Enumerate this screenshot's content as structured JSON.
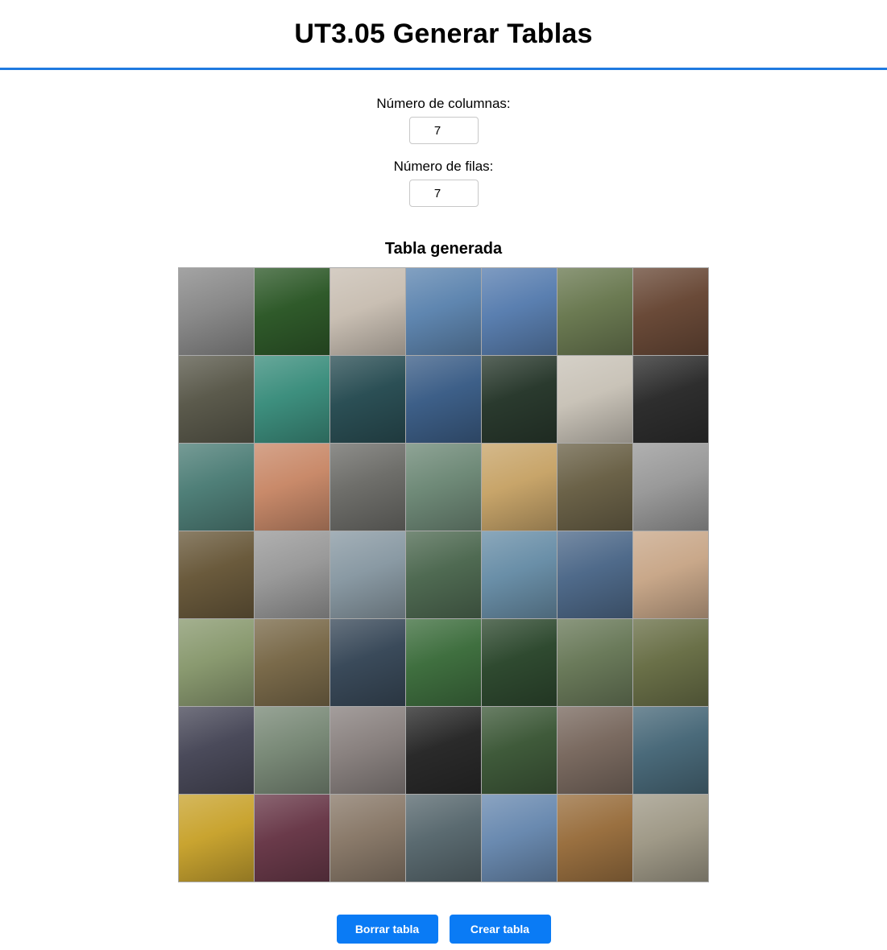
{
  "header": {
    "title": "UT3.05 Generar Tablas"
  },
  "form": {
    "columns_label": "Número de columnas:",
    "columns_value": "7",
    "rows_label": "Número de filas:",
    "rows_value": "7"
  },
  "table": {
    "title": "Tabla generada",
    "tiles": [
      [
        "#8a8a8a",
        "#2f5a2a",
        "#c9bfb3",
        "#5f86b0",
        "#5a7fb0",
        "#6b7a52",
        "#6a4a38"
      ],
      [
        "#5b5a4c",
        "#3d8f7e",
        "#2b4f55",
        "#3d5f88",
        "#2a3a2e",
        "#c9c3b8",
        "#2e2e2e"
      ],
      [
        "#4f7f78",
        "#c98a6a",
        "#6e6e6a",
        "#6f8a78",
        "#c8a56a",
        "#6b6248",
        "#9a9a9a"
      ],
      [
        "#6a5a3c",
        "#9a9a9a",
        "#8a9aa4",
        "#4f6a52",
        "#6a8fa8",
        "#4f6a8a",
        "#c9a88a"
      ],
      [
        "#8a9a70",
        "#7a6a4a",
        "#3a4a5a",
        "#3f6f3f",
        "#2f4a30",
        "#6a7a5a",
        "#6a7048"
      ],
      [
        "#4a4a5a",
        "#7a8a78",
        "#8a8280",
        "#2a2a2a",
        "#3f5a3a",
        "#7a6a60",
        "#4a6a7a"
      ],
      [
        "#c9a430",
        "#6a3a4a",
        "#8a7a6a",
        "#5a6a70",
        "#6a8ab0",
        "#9a7040",
        "#a09a88"
      ]
    ]
  },
  "buttons": {
    "clear_label": "Borrar tabla",
    "create_label": "Crear tabla",
    "color": "#0a7bf5"
  },
  "accent": "#1f7ae0"
}
